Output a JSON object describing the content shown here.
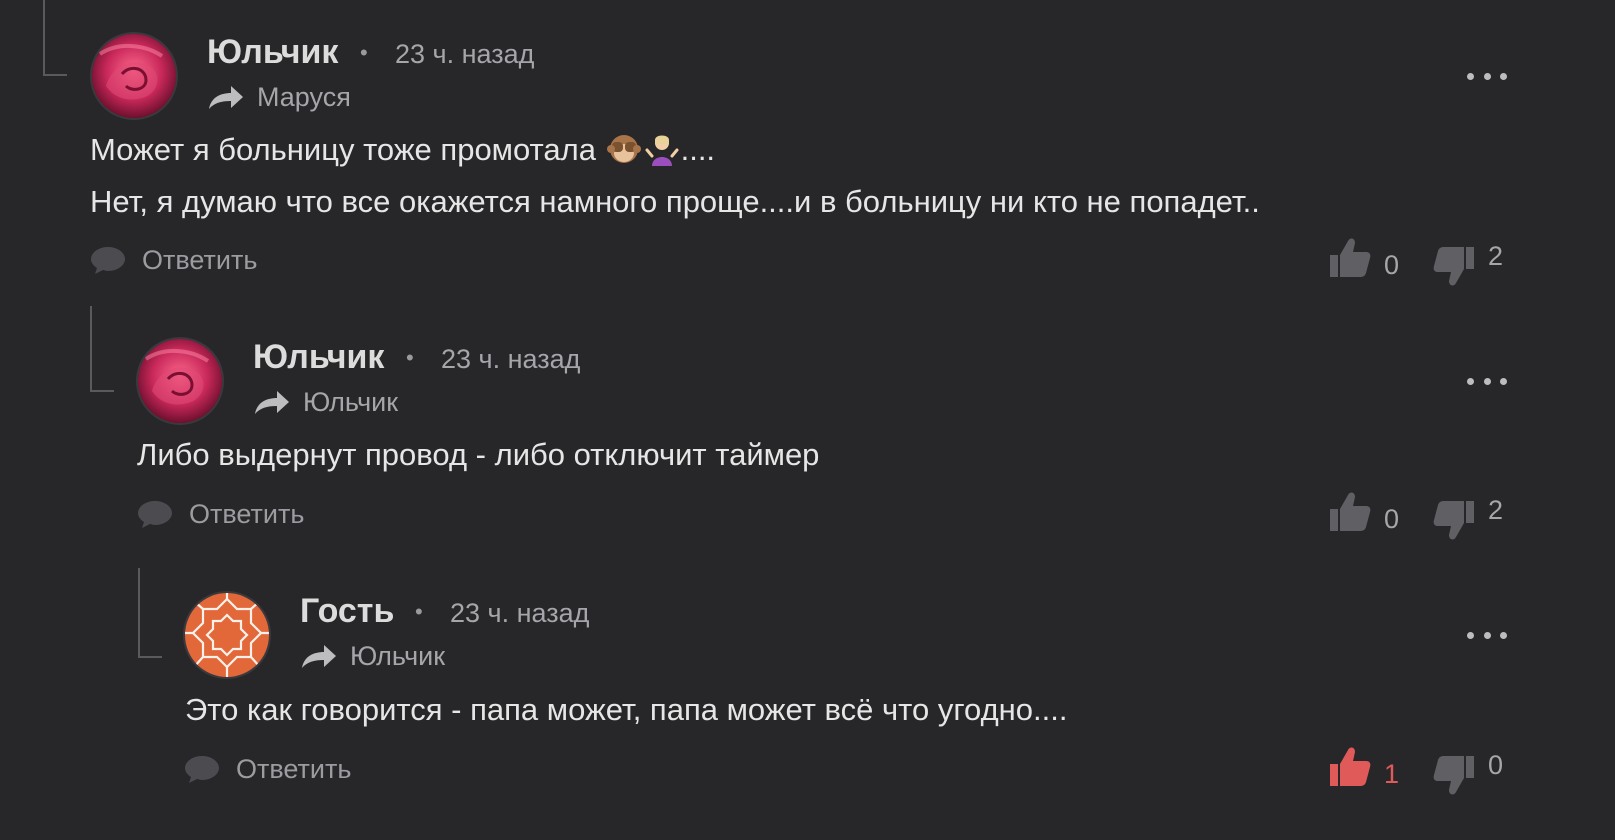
{
  "comments": [
    {
      "author": "Юльчик",
      "time": "23 ч. назад",
      "reply_to": "Маруся",
      "text_line1_before": "Может я больницу тоже промотала ",
      "text_line1_after": "....",
      "text_line2": "Нет, я думаю что все окажется намного проще....и в больницу ни кто не попадет..",
      "answer_label": "Ответить",
      "likes": "0",
      "dislikes": "2"
    },
    {
      "author": "Юльчик",
      "time": "23 ч. назад",
      "reply_to": "Юльчик",
      "text_line1": "Либо выдернут провод - либо отключит таймер",
      "answer_label": "Ответить",
      "likes": "0",
      "dislikes": "2"
    },
    {
      "author": "Гость",
      "time": "23 ч. назад",
      "reply_to": "Юльчик",
      "text_line1": "Это как говорится - папа может, папа может всё что угодно....",
      "answer_label": "Ответить",
      "likes": "1",
      "dislikes": "0"
    }
  ],
  "colors": {
    "background": "#27272a",
    "accent_like": "#e05a5a",
    "avatar_rose": "#c8285a",
    "avatar_pattern": "#e2683a"
  },
  "icons": [
    "reply-arrow-icon",
    "speech-bubble-icon",
    "thumbs-up-icon",
    "thumbs-down-icon",
    "more-dots-icon",
    "see-no-evil-monkey-icon",
    "shrug-icon"
  ]
}
